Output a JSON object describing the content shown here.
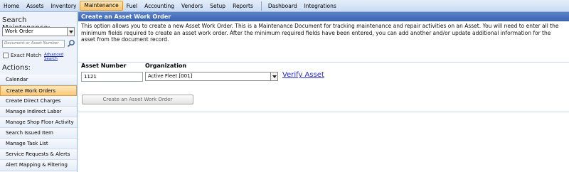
{
  "menu": {
    "items": [
      {
        "label": "Home"
      },
      {
        "label": "Assets"
      },
      {
        "label": "Inventory"
      },
      {
        "label": "Maintenance"
      },
      {
        "label": "Fuel"
      },
      {
        "label": "Accounting"
      },
      {
        "label": "Vendors"
      },
      {
        "label": "Setup"
      },
      {
        "label": "Reports"
      },
      {
        "label": "Dashboard"
      },
      {
        "label": "Integrations"
      }
    ],
    "active": "Maintenance"
  },
  "sidebar": {
    "search_heading": "Search Maintenance:",
    "search_type_selected": "Work Order",
    "search_placeholder": "Document or Asset Number",
    "exact_match_label": "Exact Match",
    "advanced_search_label": "Advanced Search",
    "actions_heading": "Actions:",
    "actions": [
      {
        "label": "Calendar"
      },
      {
        "label": "Create Work Orders"
      },
      {
        "label": "Create Direct Charges"
      },
      {
        "label": "Manage Indirect Labor"
      },
      {
        "label": "Manage Shop Floor Activity"
      },
      {
        "label": "Search Issued Item"
      },
      {
        "label": "Manage Task List"
      },
      {
        "label": "Service Requests & Alerts"
      },
      {
        "label": "Alert Mapping & Filtering"
      }
    ],
    "selected_action": "Create Work Orders"
  },
  "main": {
    "title": "Create an Asset Work Order",
    "description": "This option allows you to create a new Asset Work Order. This is a Maintenance Document for tracking maintenance and repair activities on an Asset. You will need to enter all the minimum fields required to create an asset work order. After the minimum required fields have been entered, you can add another and/or update additional information for the asset from the document record.",
    "asset_number_label": "Asset Number",
    "asset_number_value": "1121",
    "organization_label": "Organization",
    "organization_value": "Active Fleet [001]",
    "verify_link": "Verify Asset",
    "create_button": "Create an Asset Work Order"
  },
  "colors": {
    "title_bar": "#3a62ad",
    "active_highlight": "#fbc877",
    "link": "#2a2ad0"
  }
}
